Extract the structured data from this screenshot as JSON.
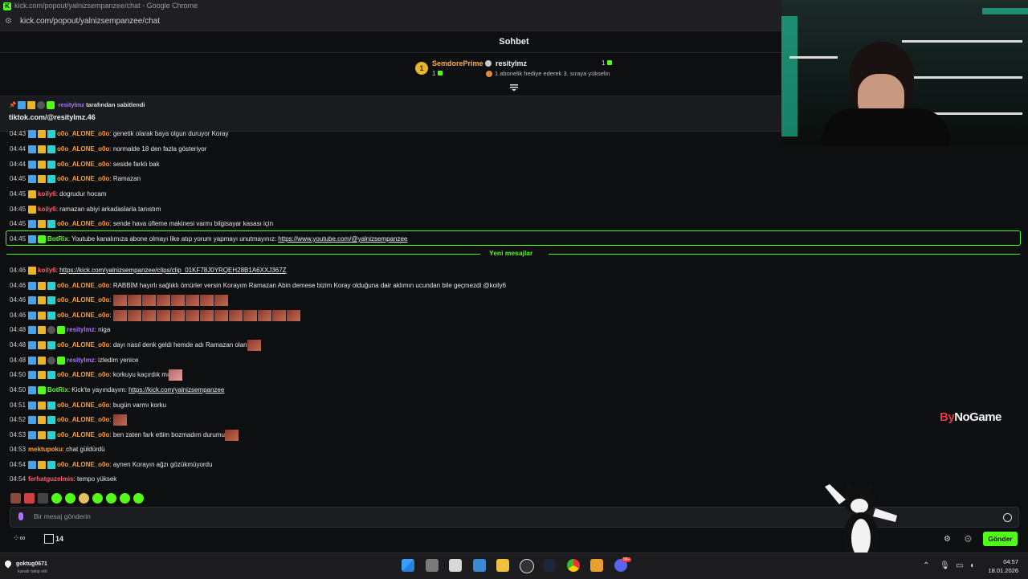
{
  "window": {
    "title": "kick.com/popout/yalnizsempanzee/chat - Google Chrome",
    "url": "kick.com/popout/yalnizsempanzee/chat"
  },
  "chat": {
    "header": "Sohbet"
  },
  "leaderboard": {
    "first": {
      "rank": "1",
      "name": "SemdorePrime",
      "count": "1"
    },
    "second": {
      "name": "resitylmz",
      "count": "1",
      "subtitle": "1 abonelik hediye ederek 3. sıraya yükselin"
    }
  },
  "pinned": {
    "author": "resitylmz",
    "suffix": "tarafından sabitlendi",
    "text": "tiktok.com/@resitylmz.46"
  },
  "messages": [
    {
      "time": "04:43",
      "user": "o0o_ALONE_o0o",
      "text": ": genetik olarak baya olgun duruyor Koray"
    },
    {
      "time": "04:44",
      "user": "o0o_ALONE_o0o",
      "text": ": normalde 18 den fazla gösteriyor"
    },
    {
      "time": "04:44",
      "user": "o0o_ALONE_o0o",
      "text": ": seside farklı bak"
    },
    {
      "time": "04:45",
      "user": "o0o_ALONE_o0o",
      "text": ": Ramazan"
    },
    {
      "time": "04:45",
      "user": "koily6",
      "text": ": dogrudur hocam"
    },
    {
      "time": "04:45",
      "user": "koily6",
      "text": ": ramazan abiyi arkadaslarla tanıstım"
    },
    {
      "time": "04:45",
      "user": "o0o_ALONE_o0o",
      "text": ": sende hava üfleme makinesi varmı bilgisayar kasası için"
    },
    {
      "time": "04:45",
      "user": "BotRix",
      "text": ": Youtube kanalımıza abone olmayı like atıp yorum yapmayı unutmayınız: ",
      "link": "https://www.youtube.com/@yalnizsempanzee"
    },
    {
      "time": "04:46",
      "user": "koily6",
      "text": ": ",
      "link": "https://kick.com/yalnizsempanzee/clips/clip_01KF78J0YRQEH28B1A6XXJ367Z"
    },
    {
      "time": "04:46",
      "user": "o0o_ALONE_o0o",
      "text": ": RABBİM hayırlı sağlıklı ömürler versin Korayım Ramazan Abin demese bizim Koray olduğuna dair aklımın ucundan bile geçmezdi @koily6"
    },
    {
      "time": "04:46",
      "user": "o0o_ALONE_o0o",
      "text": ": "
    },
    {
      "time": "04:46",
      "user": "o0o_ALONE_o0o",
      "text": ": "
    },
    {
      "time": "04:48",
      "user": "resitylmz",
      "text": ": niga"
    },
    {
      "time": "04:48",
      "user": "o0o_ALONE_o0o",
      "text": ": dayı nasıl denk geldi hemde adı Ramazan olan"
    },
    {
      "time": "04:48",
      "user": "resitylmz",
      "text": ": izledim yenice"
    },
    {
      "time": "04:50",
      "user": "o0o_ALONE_o0o",
      "text": ": korkuyu kaçırdık mı"
    },
    {
      "time": "04:50",
      "user": "BotRix",
      "text": ": Kick'te yayındayım: ",
      "link": "https://kick.com/yalnizsempanzee"
    },
    {
      "time": "04:51",
      "user": "o0o_ALONE_o0o",
      "text": ": bugün varmı korku"
    },
    {
      "time": "04:52",
      "user": "o0o_ALONE_o0o",
      "text": ": "
    },
    {
      "time": "04:53",
      "user": "o0o_ALONE_o0o",
      "text": ": ben zaten fark ettim bozmadım durumu"
    },
    {
      "time": "04:53",
      "user": "mektupoku",
      "text": ": chat güldürdü"
    },
    {
      "time": "04:54",
      "user": "o0o_ALONE_o0o",
      "text": ": aynen Korayın ağzı gözükmüyordu"
    },
    {
      "time": "04:54",
      "user": "ferhatguzelmis",
      "text": ": tempo yüksek"
    }
  ],
  "new_messages_label": "Yeni mesajlar",
  "input": {
    "placeholder": "Bir mesaj gönderin"
  },
  "footer": {
    "count": "14",
    "send": "Gönder"
  },
  "overlay": {
    "brand_by": "By",
    "brand_rest": "NoGame"
  },
  "taskbar": {
    "user": "goktug0671",
    "sub": "kanalı takip etti",
    "time": "04:57",
    "date": "18.01.2026",
    "badge": "99+"
  },
  "colors": {
    "accent": "#53fc18",
    "orange": "#ff9d2b",
    "purple": "#b070ff",
    "red": "#ff5c6e"
  }
}
